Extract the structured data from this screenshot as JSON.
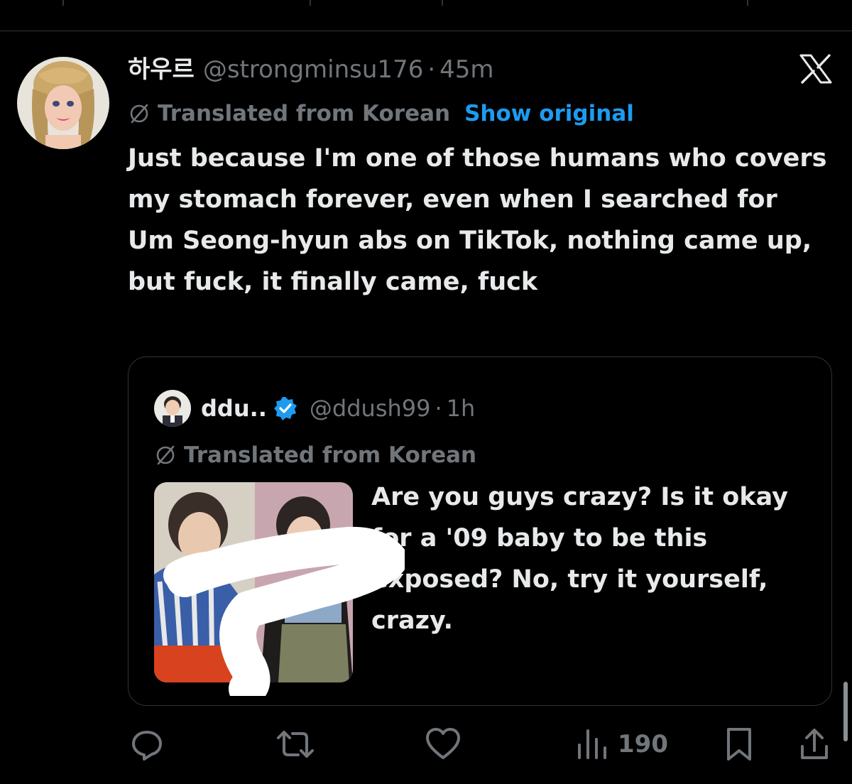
{
  "post": {
    "display_name": "하우르",
    "handle": "@strongminsu176",
    "separator": "·",
    "time": "45m",
    "translated_label": "Translated from Korean",
    "show_original": "Show original",
    "text": "Just because I'm one of those humans who covers my stomach forever, even when I searched for Um Seong-hyun abs on TikTok, nothing came up, but fuck, it finally came, fuck"
  },
  "quote": {
    "display_name": "ddu..",
    "handle": "@ddush99",
    "separator": "·",
    "time": "1h",
    "translated_label": "Translated from Korean",
    "text": "Are you guys crazy? Is it okay for a '09 baby to be this exposed? No, try it yourself, crazy."
  },
  "actions": {
    "views": "190"
  },
  "icons": {
    "brand": "x-logo-icon",
    "translate": "globe-slash-icon",
    "verified": "verified-badge-icon",
    "reply": "reply-icon",
    "repost": "repost-icon",
    "like": "heart-icon",
    "views": "views-chart-icon",
    "bookmark": "bookmark-icon",
    "share": "share-icon"
  },
  "colors": {
    "background": "#000000",
    "text": "#e7e9ea",
    "muted": "#71767b",
    "accent": "#1d9bf0",
    "border": "#2f3336"
  }
}
